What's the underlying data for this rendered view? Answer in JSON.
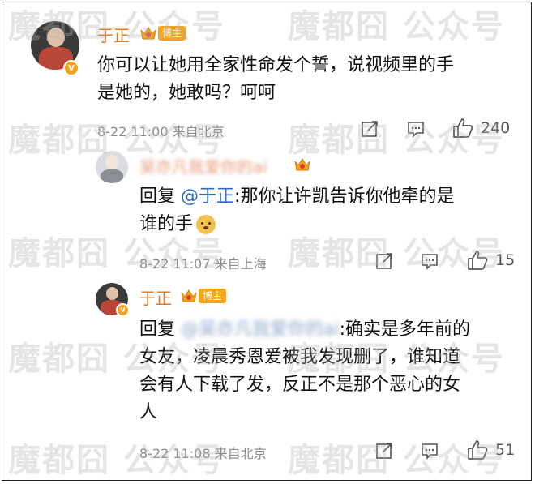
{
  "watermark": "魔都囧 公众号",
  "comments": [
    {
      "user": "于正",
      "badge": "博主",
      "lines": [
        "你可以让她用全家性命发个誓，说视频里的手",
        "是她的，她敢吗？呵呵"
      ],
      "date": "8-22 11:00",
      "source": "来自北京",
      "likes": "240"
    },
    {
      "user": "吴亦凡我爱你的ai",
      "reply_prefix": "回复",
      "mention": "@于正",
      "lines": [
        ":那你让许凯告诉你他牵的是",
        "谁的手"
      ],
      "date": "8-22 11:07",
      "source": "来自上海",
      "likes": "15"
    },
    {
      "user": "于正",
      "badge": "博主",
      "reply_prefix": "回复",
      "mention": "@吴亦凡我爱你的ai",
      "lines": [
        ":确实是多年前的",
        "女友，凌晨秀恩爱被我发现删了，谁知道",
        "会有人下载了发，反正不是那个恶心的女",
        "人"
      ],
      "date": "8-22 11:08",
      "source": "来自北京",
      "likes": "51"
    }
  ],
  "colors": {
    "username": "#e6781e",
    "mention": "#2a6cc4",
    "meta": "#8a8a8a",
    "badge": "#f7a21b"
  },
  "icons": [
    "share-icon",
    "comment-icon",
    "like-icon",
    "crown-icon",
    "verified-icon",
    "doge-emoji"
  ]
}
